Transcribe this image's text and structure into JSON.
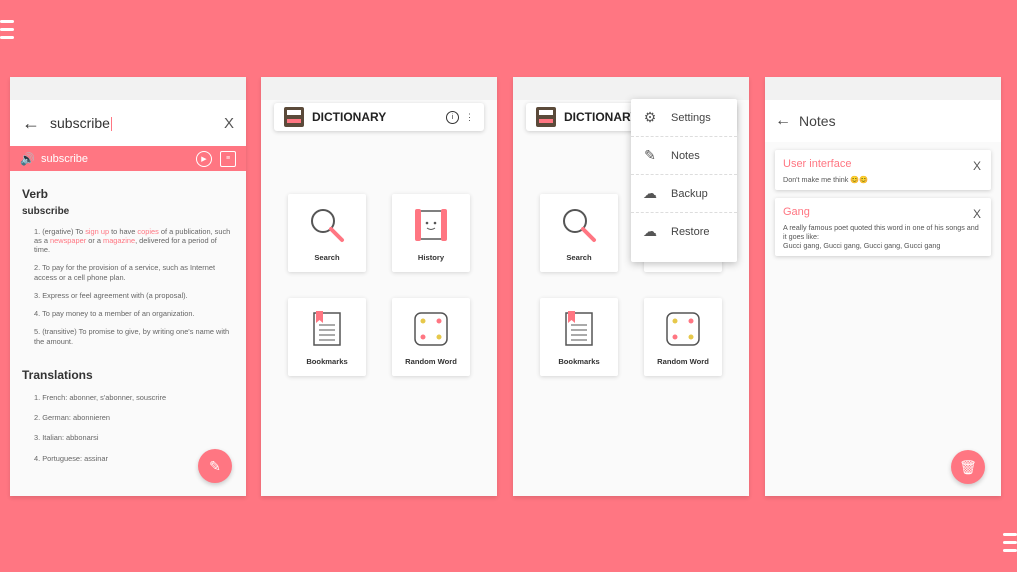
{
  "screen1": {
    "back": "←",
    "query": "subscribe",
    "clear": "X",
    "word_bar": "subscribe",
    "pos": "Verb",
    "word": "subscribe",
    "definitions": [
      {
        "parts": [
          "1. (ergative) To ",
          "sign up",
          " to have ",
          "copies",
          " of a publication, such as a ",
          "newspaper",
          " or a ",
          "magazine",
          ", delivered for a period of time."
        ]
      },
      {
        "text": "2. To pay for the provision of a service, such as Internet access or a cell phone plan."
      },
      {
        "text": "3. Express or feel agreement with (a proposal)."
      },
      {
        "text": "4. To pay money to a member of an organization."
      },
      {
        "text": "5. (transitive) To promise to give, by writing one's name with the amount."
      }
    ],
    "translations_title": "Translations",
    "translations": [
      "1. French: abonner, s'abonner, souscrire",
      "2. German: abonnieren",
      "3. Italian: abbonarsi",
      "4. Portuguese: assinar"
    ]
  },
  "app_title": "DICTIONARY",
  "tiles": [
    {
      "label": "Search",
      "icon": "search-icon"
    },
    {
      "label": "History",
      "icon": "scroll-icon"
    },
    {
      "label": "Bookmarks",
      "icon": "bookmark-doc-icon"
    },
    {
      "label": "Random Word",
      "icon": "dice-icon"
    }
  ],
  "menu": [
    "Settings",
    "Notes",
    "Backup",
    "Restore"
  ],
  "notes_screen": {
    "title": "Notes",
    "notes": [
      {
        "title": "User interface",
        "body": "Don't make me think 😊😊"
      },
      {
        "title": "Gang",
        "body": "A really famous poet quoted this word in one of his songs and it goes like:\nGucci gang, Gucci gang, Gucci gang, Gucci gang"
      }
    ]
  },
  "colors": {
    "background": "#FF7682",
    "accent": "#FF7682"
  }
}
